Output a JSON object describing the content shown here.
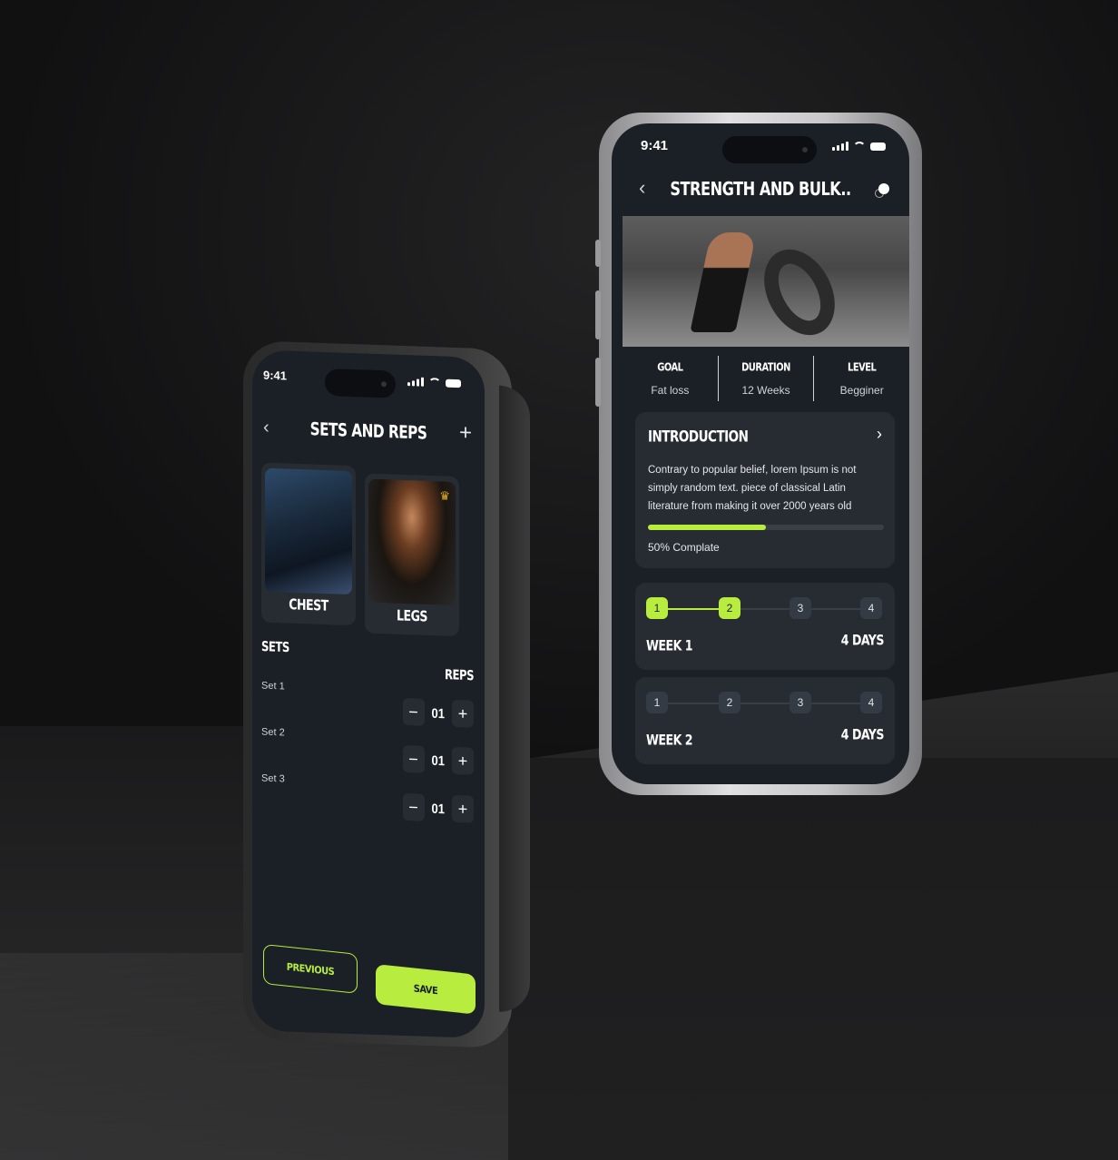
{
  "colors": {
    "accent": "#b8ec3e",
    "screen_bg": "#1b2027",
    "card_bg": "#272c33"
  },
  "left_phone": {
    "status": {
      "time": "9:41"
    },
    "header": {
      "back_icon": "chevron-left",
      "title": "SETS AND REPS",
      "add_icon": "+"
    },
    "categories": [
      {
        "label": "CHEST",
        "badge": null
      },
      {
        "label": "LEGS",
        "badge": "crown"
      }
    ],
    "sets_label": "SETS",
    "reps_label": "REPS",
    "sets": [
      {
        "label": "Set 1",
        "reps": "01",
        "minus": "−",
        "plus": "+"
      },
      {
        "label": "Set 2",
        "reps": "01",
        "minus": "−",
        "plus": "+"
      },
      {
        "label": "Set 3",
        "reps": "01",
        "minus": "−",
        "plus": "+"
      }
    ],
    "buttons": {
      "previous": "PREVIOUS",
      "save": "SAVE"
    }
  },
  "right_phone": {
    "status": {
      "time": "9:41"
    },
    "header": {
      "back_icon": "chevron-left",
      "title": "STRENGTH AND BULK..",
      "share_icon": "share"
    },
    "stats": [
      {
        "key": "GOAL",
        "value": "Fat loss"
      },
      {
        "key": "DURATION",
        "value": "12 Weeks"
      },
      {
        "key": "LEVEL",
        "value": "Begginer"
      }
    ],
    "intro": {
      "title": "INTRODUCTION",
      "chevron": "›",
      "text": "Contrary to popular belief, lorem Ipsum is not simply random text. piece of classical Latin literature from making it over 2000 years old",
      "progress_percent": 50,
      "progress_label": "50% Complate"
    },
    "weeks": [
      {
        "label": "WEEK 1",
        "days_label": "4 DAYS",
        "steps": [
          "1",
          "2",
          "3",
          "4"
        ],
        "completed": 2
      },
      {
        "label": "WEEK 2",
        "days_label": "4 DAYS",
        "steps": [
          "1",
          "2",
          "3",
          "4"
        ],
        "completed": 0
      }
    ]
  }
}
